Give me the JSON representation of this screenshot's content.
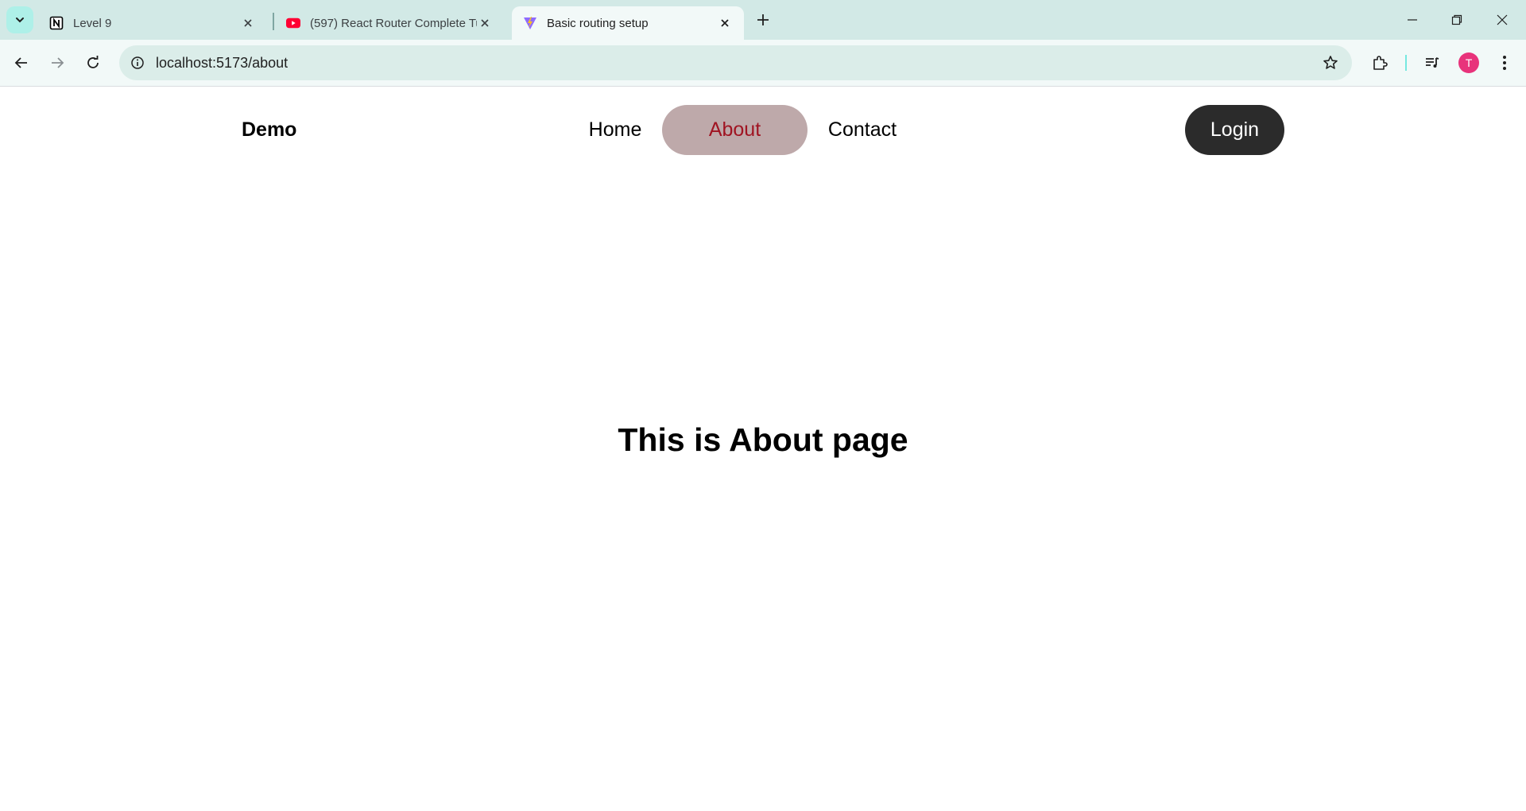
{
  "browser": {
    "tabs": [
      {
        "title": "Level 9",
        "favicon": "notion-icon",
        "active": false
      },
      {
        "title": "(597) React Router Complete Tu",
        "favicon": "youtube-icon",
        "active": false
      },
      {
        "title": "Basic routing setup",
        "favicon": "vite-icon",
        "active": true
      }
    ],
    "address": "localhost:5173/about",
    "profile_initial": "T",
    "colors": {
      "tabstrip": "#d2e9e6",
      "toolbar": "#f2f9f8",
      "omnibox": "#dbede9",
      "avatar": "#e8337b"
    }
  },
  "page": {
    "nav": {
      "logo": "Demo",
      "links": [
        {
          "label": "Home",
          "active": false
        },
        {
          "label": "About",
          "active": true
        },
        {
          "label": "Contact",
          "active": false
        }
      ],
      "login_label": "Login"
    },
    "heading": "This is About page",
    "colors": {
      "active_pill": "#bea9aa",
      "active_text": "#a01422",
      "login_bg": "#2b2b2b"
    }
  }
}
